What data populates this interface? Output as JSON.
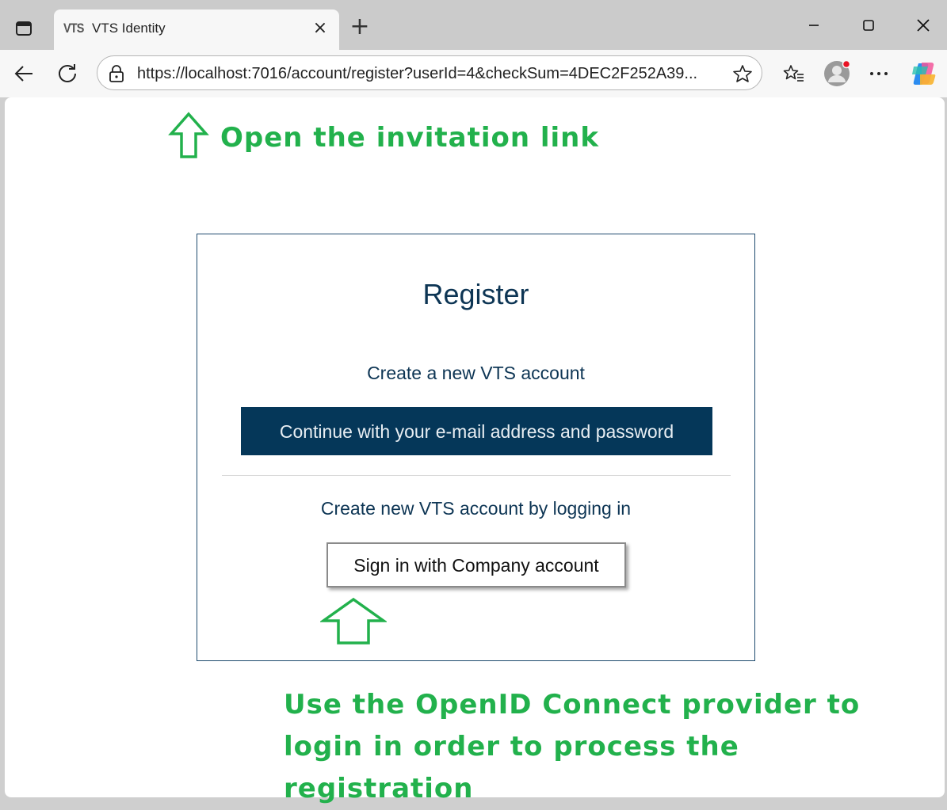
{
  "browser": {
    "tab": {
      "favicon_text": "VTS",
      "title": "VTS Identity",
      "close": "×"
    },
    "new_tab": "+",
    "address": {
      "url": "https://localhost:7016/account/register?userId=4&checkSum=4DEC2F252A39..."
    }
  },
  "annotations": {
    "top": "Open the invitation link",
    "bottom": "Use the OpenID Connect provider to login in order to process the registration",
    "color": "#22b14c"
  },
  "register": {
    "title": "Register",
    "create_new_label": "Create a new VTS account",
    "email_button_label": "Continue with your e-mail address and password",
    "login_label": "Create new VTS account by logging in",
    "company_button_label": "Sign in with Company account"
  },
  "colors": {
    "primary": "#053759",
    "text": "#0d3554"
  },
  "icons": [
    "tab-actions-icon",
    "close-icon",
    "plus-icon",
    "minimize-icon",
    "maximize-icon",
    "back-icon",
    "refresh-icon",
    "lock-icon",
    "favorite-star-icon",
    "favorites-list-icon",
    "profile-avatar-icon",
    "more-icon",
    "copilot-icon",
    "up-arrow-icon"
  ]
}
